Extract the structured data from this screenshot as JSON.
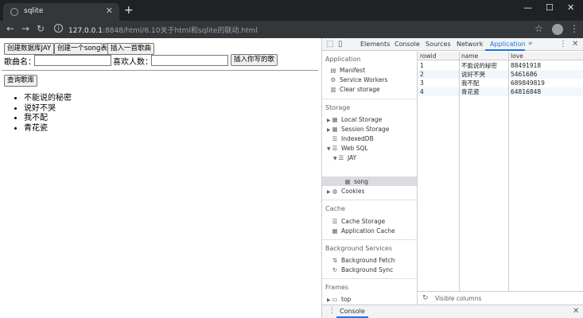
{
  "browser": {
    "tab_title": "sqlite",
    "url_host": "127.0.0.1",
    "url_rest": ":8848/html/6.10关于html和sqlite的联动.html"
  },
  "page": {
    "buttons": {
      "create_db": "创建数据库JAY",
      "create_table": "创建一个song表",
      "insert_song": "插入一首歌曲",
      "insert_your_song": "插入你写的歌",
      "query": "查询歌库"
    },
    "labels": {
      "song_name": "歌曲名：",
      "likes": "喜欢人数："
    },
    "inputs": {
      "song_name_value": "",
      "likes_value": ""
    },
    "songs": [
      "不能说的秘密",
      "说好不哭",
      "我不配",
      "青花瓷"
    ]
  },
  "devtools": {
    "tabs": [
      "Elements",
      "Console",
      "Sources",
      "Network",
      "Application"
    ],
    "active_tab": "Application",
    "sidebar": {
      "application_header": "Application",
      "application_items": [
        "Manifest",
        "Service Workers",
        "Clear storage"
      ],
      "storage_header": "Storage",
      "storage_items": [
        "Local Storage",
        "Session Storage",
        "IndexedDB",
        "Web SQL",
        "JAY",
        "song",
        "Cookies"
      ],
      "cache_header": "Cache",
      "cache_items": [
        "Cache Storage",
        "Application Cache"
      ],
      "bg_header": "Background Services",
      "bg_items": [
        "Background Fetch",
        "Background Sync"
      ],
      "frames_header": "Frames",
      "frames_items": [
        "top"
      ]
    },
    "table": {
      "columns": [
        "rowid",
        "name",
        "love"
      ],
      "rows": [
        [
          "1",
          "不能说的秘密",
          "88491918"
        ],
        [
          "2",
          "说好不哭",
          "5461686"
        ],
        [
          "3",
          "我不配",
          "689849819"
        ],
        [
          "4",
          "青花瓷",
          "64816848"
        ]
      ],
      "footer": "Visible columns"
    },
    "drawer_tab": "Console"
  }
}
